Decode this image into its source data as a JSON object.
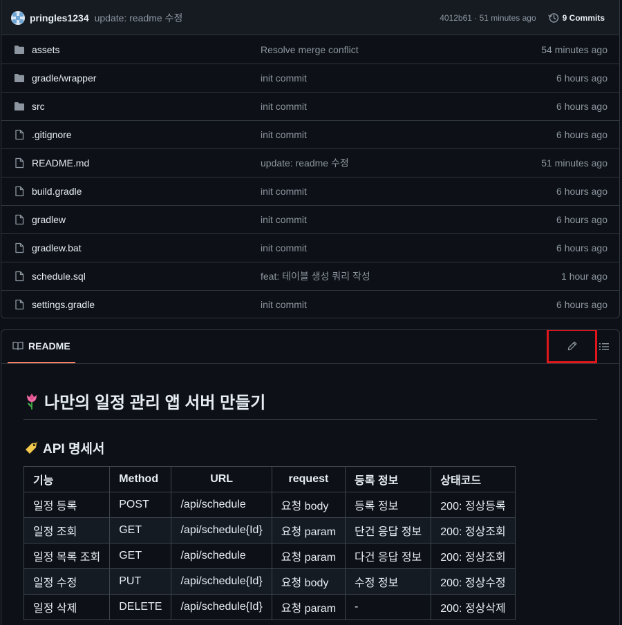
{
  "latest_commit": {
    "author": "pringles1234",
    "message": "update: readme 수정",
    "meta": "4012b61 · 51 minutes ago",
    "commits_label": "9 Commits"
  },
  "files": [
    {
      "type": "folder",
      "icon": "folder-icon",
      "name": "assets",
      "message": "Resolve merge conflict",
      "time": "54 minutes ago"
    },
    {
      "type": "folder",
      "icon": "folder-icon",
      "name": "gradle/wrapper",
      "message": "init commit",
      "time": "6 hours ago"
    },
    {
      "type": "folder",
      "icon": "folder-icon",
      "name": "src",
      "message": "init commit",
      "time": "6 hours ago"
    },
    {
      "type": "file",
      "icon": "file-icon",
      "name": ".gitignore",
      "message": "init commit",
      "time": "6 hours ago"
    },
    {
      "type": "file",
      "icon": "file-icon",
      "name": "README.md",
      "message": "update: readme 수정",
      "time": "51 minutes ago"
    },
    {
      "type": "file",
      "icon": "file-icon",
      "name": "build.gradle",
      "message": "init commit",
      "time": "6 hours ago"
    },
    {
      "type": "file",
      "icon": "file-icon",
      "name": "gradlew",
      "message": "init commit",
      "time": "6 hours ago"
    },
    {
      "type": "file",
      "icon": "file-icon",
      "name": "gradlew.bat",
      "message": "init commit",
      "time": "6 hours ago"
    },
    {
      "type": "file",
      "icon": "file-icon",
      "name": "schedule.sql",
      "message": "feat: 테이블 생성 쿼리 작성",
      "time": "1 hour ago"
    },
    {
      "type": "file",
      "icon": "file-icon",
      "name": "settings.gradle",
      "message": "init commit",
      "time": "6 hours ago"
    }
  ],
  "readme": {
    "tab_label": "README",
    "title": "나만의 일정 관리 앱 서버 만들기",
    "title_emoji": "tulip-icon",
    "section_title": "API 명세서",
    "section_emoji": "label-tag-icon",
    "table": {
      "headers": [
        "기능",
        "Method",
        "URL",
        "request",
        "등록 정보",
        "상태코드"
      ],
      "rows": [
        [
          "일정 등록",
          "POST",
          "/api/schedule",
          "요청 body",
          "등록 정보",
          "200: 정상등록"
        ],
        [
          "일정 조회",
          "GET",
          "/api/schedule{Id}",
          "요청 param",
          "단건 응답 정보",
          "200: 정상조회"
        ],
        [
          "일정 목록 조회",
          "GET",
          "/api/schedule",
          "요청 param",
          "다건 응답 정보",
          "200: 정상조회"
        ],
        [
          "일정 수정",
          "PUT",
          "/api/schedule{Id}",
          "요청 body",
          "수정 정보",
          "200: 정상수정"
        ],
        [
          "일정 삭제",
          "DELETE",
          "/api/schedule{Id}",
          "요청 param",
          "-",
          "200: 정상삭제"
        ]
      ]
    }
  },
  "colors": {
    "background": "#0d1117",
    "border": "#30363d",
    "muted_text": "#8d96a0",
    "tab_underline": "#f78166",
    "highlight_box": "#e0161b"
  }
}
